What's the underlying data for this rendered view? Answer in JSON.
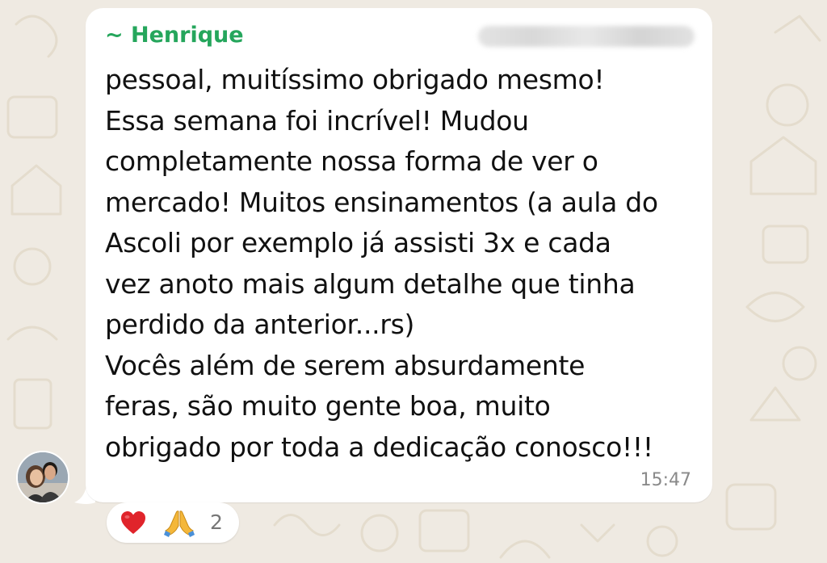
{
  "chat": {
    "sender_name": "~ Henrique",
    "message_text": "pessoal, muitíssimo obrigado mesmo!\nEssa semana foi incrível! Mudou\ncompletamente nossa forma de ver o\nmercado! Muitos ensinamentos (a aula do\nAscoli por exemplo já assisti 3x e cada\nvez anoto mais algum detalhe que tinha\nperdido da anterior...rs)\nVocês além de serem absurdamente\nferas, são muito gente boa, muito\nobrigado por toda a dedicação conosco!!!",
    "timestamp": "15:47"
  },
  "reactions": {
    "items": [
      {
        "icon": "red-heart-icon"
      },
      {
        "icon": "folded-hands-icon"
      }
    ],
    "count": "2"
  },
  "theme": {
    "wallpaper": "#efeae2",
    "doodle": "#e4dccd",
    "bubble": "#ffffff",
    "sender_name_color": "#25a65c",
    "timestamp_color": "#8a8a8a",
    "heart": "#e0242b",
    "hands": "#f4b73a"
  }
}
